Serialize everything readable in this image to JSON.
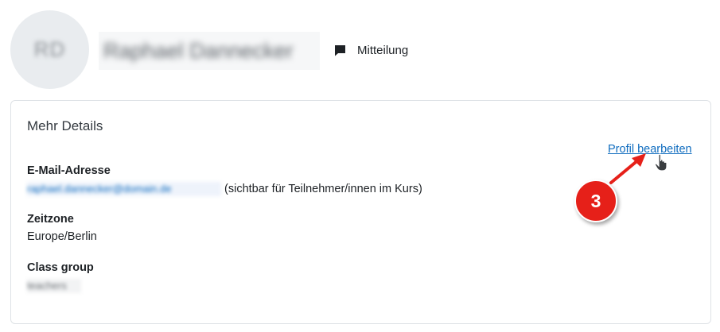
{
  "header": {
    "avatar_initials": "RD",
    "user_name": "Raphael Dannecker",
    "message_label": "Mitteilung",
    "message_icon": "speech-bubble-icon"
  },
  "details": {
    "title": "Mehr Details",
    "edit_profile_label": "Profil bearbeiten",
    "email": {
      "label": "E-Mail-Adresse",
      "value": "raphael.dannecker@domain.de",
      "note": "(sichtbar für Teilnehmer/innen im Kurs)"
    },
    "timezone": {
      "label": "Zeitzone",
      "value": "Europe/Berlin"
    },
    "class_group": {
      "label": "Class group",
      "value": "teachers"
    }
  },
  "annotation": {
    "step_number": "3",
    "color": "#e62019"
  },
  "colors": {
    "link": "#0f6cbf",
    "card_border": "#dee2e6",
    "avatar_bg": "#e9ecef"
  }
}
